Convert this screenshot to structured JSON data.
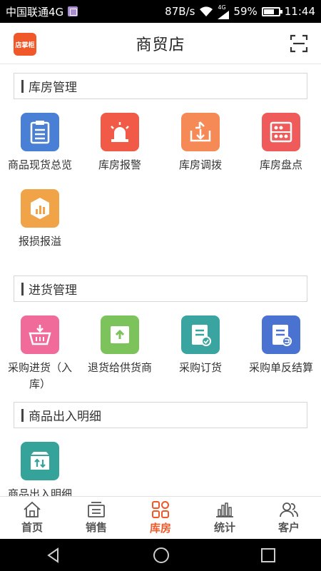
{
  "status_bar": {
    "carrier": "中国联通4G",
    "speed": "87B/s",
    "battery": "59%",
    "time": "11:44",
    "network_badge": "4G"
  },
  "header": {
    "logo_text": "店掌柜",
    "title": "商贸店",
    "scan_icon": "scan-icon"
  },
  "sections": [
    {
      "title": "库房管理",
      "items": [
        {
          "label": "商品现货总览",
          "icon": "clipboard-icon",
          "color": "#4a7fd6"
        },
        {
          "label": "库房报警",
          "icon": "alarm-icon",
          "color": "#f05a47"
        },
        {
          "label": "库房调拨",
          "icon": "transfer-icon",
          "color": "#f58a56"
        },
        {
          "label": "库房盘点",
          "icon": "abacus-icon",
          "color": "#ef5b5b"
        },
        {
          "label": "报损报溢",
          "icon": "report-chart-icon",
          "color": "#f1a347"
        }
      ]
    },
    {
      "title": "进货管理",
      "items": [
        {
          "label": "采购进货（入库）",
          "icon": "basket-icon",
          "color": "#f06a9a"
        },
        {
          "label": "退货给供货商",
          "icon": "return-box-icon",
          "color": "#7cc35c"
        },
        {
          "label": "采购订货",
          "icon": "order-doc-icon",
          "color": "#3aa4a0"
        },
        {
          "label": "采购单反结算",
          "icon": "reverse-doc-icon",
          "color": "#4a72d0"
        }
      ]
    },
    {
      "title": "商品出入明细",
      "items": [
        {
          "label": "商品出入明细",
          "icon": "inout-box-icon",
          "color": "#36a39b"
        }
      ]
    }
  ],
  "bottom_nav": [
    {
      "label": "首页",
      "icon": "home-icon",
      "active": false
    },
    {
      "label": "销售",
      "icon": "sales-icon",
      "active": false
    },
    {
      "label": "库房",
      "icon": "warehouse-grid-icon",
      "active": true
    },
    {
      "label": "统计",
      "icon": "stats-icon",
      "active": false
    },
    {
      "label": "客户",
      "icon": "customers-icon",
      "active": false
    }
  ],
  "colors": {
    "accent": "#f0582a",
    "nav_inactive": "#555555"
  }
}
